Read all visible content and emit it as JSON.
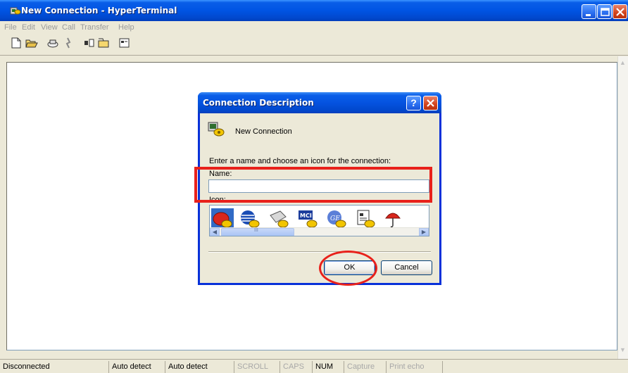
{
  "window": {
    "title": "New Connection - HyperTerminal",
    "controls": [
      "minimize-icon",
      "maximize-icon",
      "close-icon"
    ]
  },
  "menubar": {
    "items": [
      "File",
      "Edit",
      "View",
      "Call",
      "Transfer",
      "Help"
    ]
  },
  "toolbar": {
    "icons": [
      "new-icon",
      "open-icon",
      "connect-icon",
      "disconnect-icon",
      "send-icon",
      "receive-icon",
      "properties-icon"
    ]
  },
  "dialog": {
    "title": "Connection Description",
    "help_label": "?",
    "connection_name": "New Connection",
    "prompt": "Enter a name and choose an icon for the connection:",
    "name_label": "Name:",
    "name_value": "",
    "icon_label": "Icon:",
    "icons": [
      "phone-icon",
      "globe-icon",
      "printer-icon",
      "mci-icon",
      "ge-icon",
      "document-icon",
      "umbrella-icon"
    ],
    "ok_label": "OK",
    "cancel_label": "Cancel",
    "scroll_thumb": "III"
  },
  "statusbar": {
    "connection": "Disconnected",
    "detect1": "Auto detect",
    "detect2": "Auto detect",
    "scroll": "SCROLL",
    "caps": "CAPS",
    "num": "NUM",
    "capture": "Capture",
    "print_echo": "Print echo"
  },
  "colors": {
    "titlebar": "#0054e3",
    "annotation": "#e8211b",
    "dialog_bg": "#ece9d8"
  }
}
